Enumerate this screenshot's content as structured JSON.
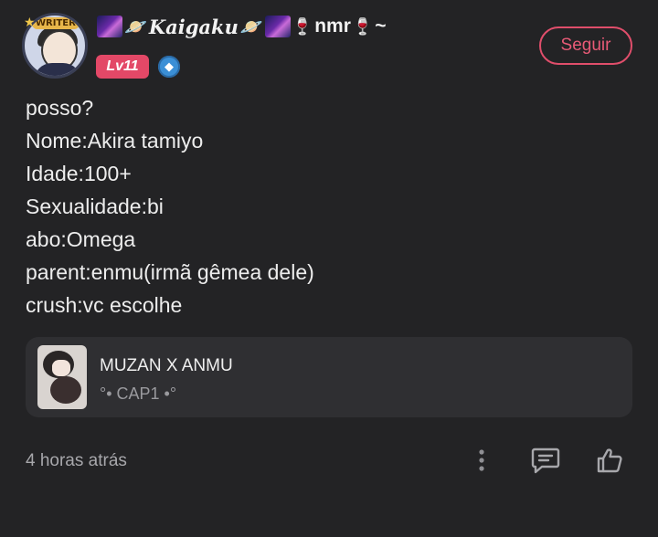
{
  "author": {
    "name_part1": "Kaigaku",
    "name_part2": "nmr",
    "name_suffix": "~",
    "avatar_badge": "WRITER",
    "level": "Lv11",
    "follow_label": "Seguir"
  },
  "post": {
    "lines": [
      "posso?",
      "Nome:Akira tamiyo",
      "Idade:100+",
      "Sexualidade:bi",
      "abo:Omega",
      "parent:enmu(irmã gêmea dele)",
      "crush:vc escolhe"
    ]
  },
  "linked_card": {
    "title": "MUZAN X ANMU",
    "subtitle": "°• CAP1 •°"
  },
  "footer": {
    "timestamp": "4 horas atrás"
  },
  "icons": {
    "more": "more-vertical-icon",
    "comment": "comment-icon",
    "like": "thumbs-up-icon",
    "verify": "verified-icon"
  },
  "colors": {
    "background": "#232325",
    "accent": "#e04e6b",
    "card": "#2f2f32",
    "muted": "#a7a7ab"
  }
}
